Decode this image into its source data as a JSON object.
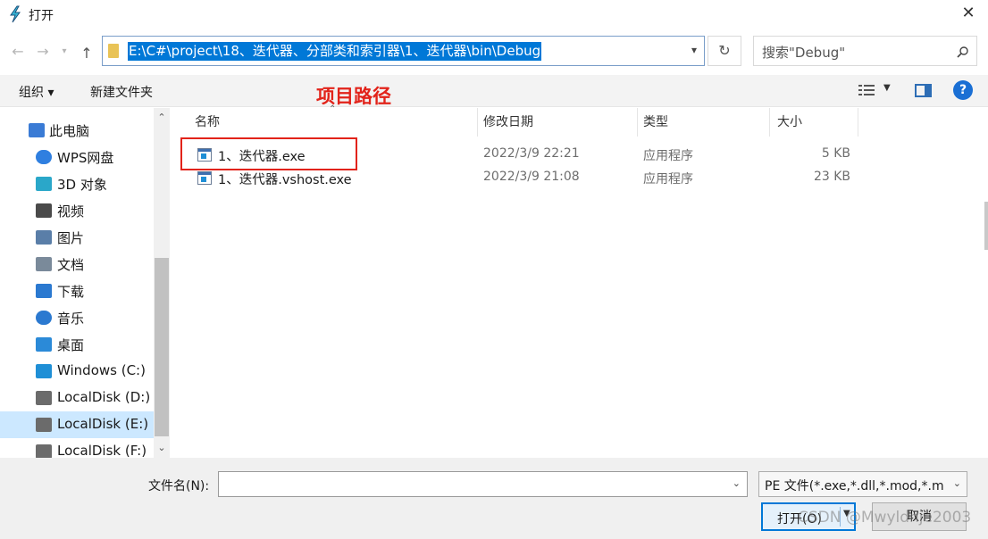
{
  "window": {
    "title": "打开",
    "close_glyph": "✕"
  },
  "nav": {
    "back_glyph": "←",
    "forward_glyph": "→",
    "up_glyph": "↑",
    "path": "E:\\C#\\project\\18、迭代器、分部类和索引器\\1、迭代器\\bin\\Debug",
    "refresh_glyph": "↻",
    "search_placeholder": "搜索\"Debug\""
  },
  "toolbar": {
    "organize": "组织 ▾",
    "new_folder": "新建文件夹",
    "help": "?"
  },
  "annotation": "项目路径",
  "sidebar": {
    "items": [
      {
        "label": "此电脑",
        "icon": "computer-icon",
        "color": "#3a7bd5"
      },
      {
        "label": "WPS网盘",
        "icon": "cloud-icon",
        "color": "#2f7fe0"
      },
      {
        "label": "3D 对象",
        "icon": "cube-icon",
        "color": "#2aa7c9"
      },
      {
        "label": "视频",
        "icon": "film-icon",
        "color": "#4a4a4a"
      },
      {
        "label": "图片",
        "icon": "picture-icon",
        "color": "#5a7ea8"
      },
      {
        "label": "文档",
        "icon": "document-icon",
        "color": "#7a8a9a"
      },
      {
        "label": "下载",
        "icon": "download-icon",
        "color": "#2b79d0"
      },
      {
        "label": "音乐",
        "icon": "music-icon",
        "color": "#2b79d0"
      },
      {
        "label": "桌面",
        "icon": "desktop-icon",
        "color": "#2b8ad8"
      },
      {
        "label": "Windows (C:)",
        "icon": "windows-drive-icon",
        "color": "#1f8fd6"
      },
      {
        "label": "LocalDisk (D:)",
        "icon": "drive-icon",
        "color": "#6b6b6b"
      },
      {
        "label": "LocalDisk (E:)",
        "icon": "drive-icon",
        "color": "#6b6b6b"
      },
      {
        "label": "LocalDisk (F:)",
        "icon": "drive-icon",
        "color": "#6b6b6b"
      }
    ]
  },
  "columns": {
    "name": "名称",
    "date": "修改日期",
    "type": "类型",
    "size": "大小"
  },
  "files": [
    {
      "name": "1、迭代器.exe",
      "date": "2022/3/9 22:21",
      "type": "应用程序",
      "size": "5 KB"
    },
    {
      "name": "1、迭代器.vshost.exe",
      "date": "2022/3/9 21:08",
      "type": "应用程序",
      "size": "23 KB"
    }
  ],
  "bottom": {
    "filename_label": "文件名(N):",
    "filename_value": "",
    "filetype": "PE 文件(*.exe,*.dll,*.mod,*.m",
    "open_label": "打开(O)",
    "cancel_label": "取消"
  },
  "watermark": "CSDN @Mwyldnje2003"
}
